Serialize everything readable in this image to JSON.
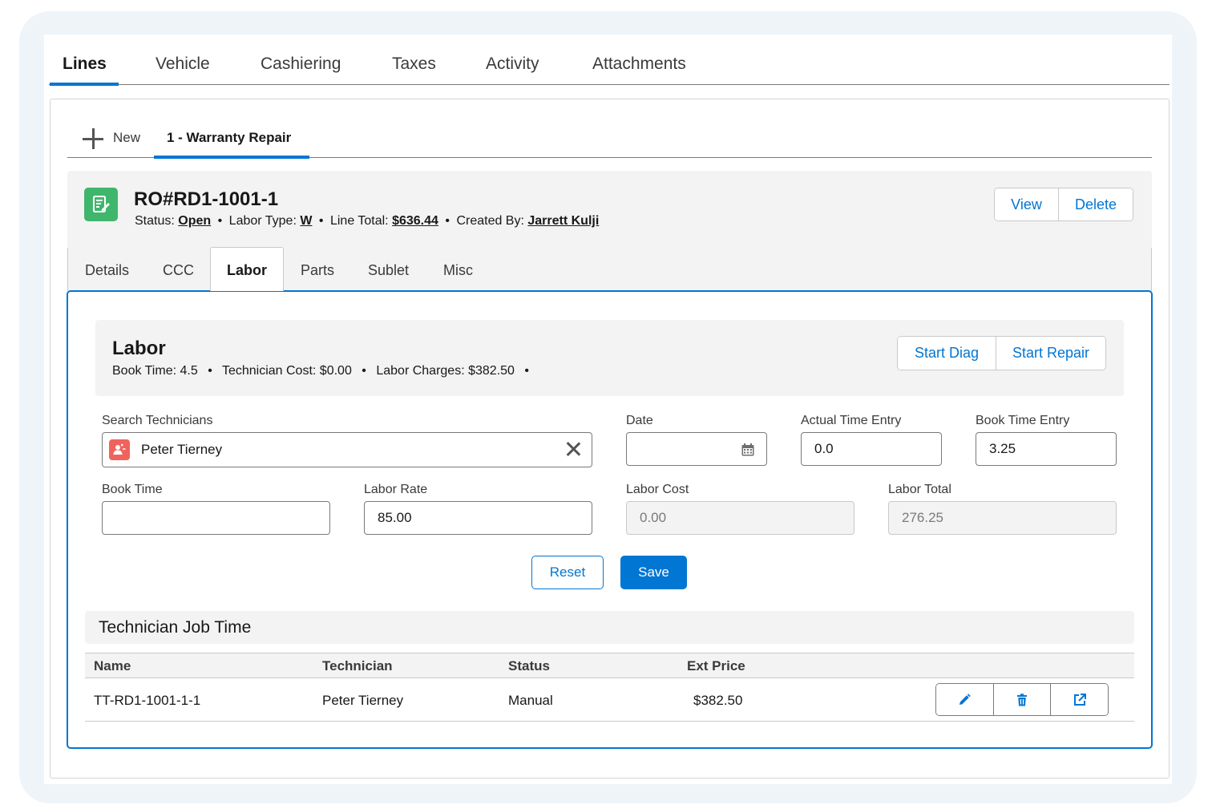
{
  "top_tabs": [
    "Lines",
    "Vehicle",
    "Cashiering",
    "Taxes",
    "Activity",
    "Attachments"
  ],
  "active_top_tab": "Lines",
  "sub_tabs": {
    "new_label": "New",
    "active_label": "1 - Warranty Repair"
  },
  "record": {
    "title": "RO#RD1-1001-1",
    "status_label": "Status:",
    "status": "Open",
    "labor_type_label": "Labor Type:",
    "labor_type": "W",
    "line_total_label": "Line Total:",
    "line_total": "$636.44",
    "created_by_label": "Created By:",
    "created_by": "Jarrett Kulji",
    "view_button": "View",
    "delete_button": "Delete"
  },
  "labor_tabs": [
    "Details",
    "CCC",
    "Labor",
    "Parts",
    "Sublet",
    "Misc"
  ],
  "active_labor_tab": "Labor",
  "labor": {
    "title": "Labor",
    "book_time_label": "Book Time:",
    "book_time": "4.5",
    "technician_cost_label": "Technician Cost:",
    "technician_cost": "$0.00",
    "labor_charges_label": "Labor Charges:",
    "labor_charges": "$382.50",
    "start_diag_button": "Start Diag",
    "start_repair_button": "Start Repair"
  },
  "form": {
    "search_technicians_label": "Search Technicians",
    "search_technicians_value": "Peter Tierney",
    "date_label": "Date",
    "date_value": "",
    "actual_time_label": "Actual Time Entry",
    "actual_time_value": "0.0",
    "book_time_entry_label": "Book Time Entry",
    "book_time_entry_value": "3.25",
    "book_time_label": "Book Time",
    "book_time_value": "",
    "labor_rate_label": "Labor Rate",
    "labor_rate_value": "85.00",
    "labor_cost_label": "Labor Cost",
    "labor_cost_value": "0.00",
    "labor_total_label": "Labor Total",
    "labor_total_value": "276.25",
    "reset_button": "Reset",
    "save_button": "Save"
  },
  "tech_job_time": {
    "title": "Technician Job Time",
    "columns": [
      "Name",
      "Technician",
      "Status",
      "Ext Price"
    ],
    "rows": [
      {
        "name": "TT-RD1-1001-1-1",
        "technician": "Peter Tierney",
        "status": "Manual",
        "ext_price": "$382.50"
      }
    ],
    "row_action_icons": [
      "edit-icon",
      "delete-icon",
      "open-external-icon"
    ]
  },
  "colors": {
    "brand": "#0176d3",
    "record_icon": "#3fb66c",
    "tech_avatar": "#f0635d",
    "panel_bg": "#f3f3f3"
  }
}
